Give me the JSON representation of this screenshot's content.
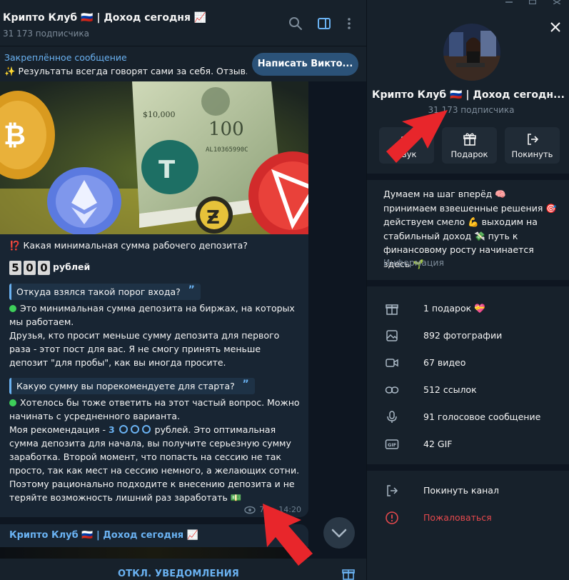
{
  "chat_header": {
    "title": "Крипто Клуб 🇷🇺 | Доход сегодня 📈",
    "subscribers": "31 173 подписчика",
    "icons": [
      "search-icon",
      "sidebar-toggle-icon",
      "more-vert-icon"
    ]
  },
  "pinned": {
    "label": "Закреплённое сообщение",
    "text": "✨ Результаты всегда говорят сами за себя. Отзыв...",
    "button": "Написать Викто..."
  },
  "message": {
    "question": "⁉️ Какая минимальная сумма рабочего депозита?",
    "amount_digits": [
      "5",
      "0",
      "0"
    ],
    "amount_unit": "рублей",
    "quote1": "Откуда взялся такой порог входа?",
    "quote_mark": "”",
    "p1": "Это минимальная сумма депозита на биржах, на которых мы работаем.",
    "p2": "Друзья, кто просит меньше сумму депозита для первого раза - этот пост для вас. Я не смогу принять меньше депозит \"для пробы\", как вы иногда просите.",
    "quote2": "Какую сумму вы порекомендуете для старта?",
    "p3": "Хотелось бы тоже ответить на этот частый вопрос. Можно начинать с усредненного варианта.",
    "p4a": "Моя рекомендация - ",
    "p4_digit": "3",
    "p4b": "рублей. Это оптимальная сумма депозита для начала, вы получите серьезную сумму заработка. Второй момент, что попасть на сессию не так просто, так как мест на сессию немного, а желающих сотни. Поэтому рационально подходите к внесению депозита и не теряйте возможность лишний раз заработать 💵",
    "views": "74",
    "time": "14:20"
  },
  "next_message": {
    "title": "Крипто Клуб 🇷🇺 | Доход сегодня 📈"
  },
  "bottom": {
    "mute": "ОТКЛ. УВЕДОМЛЕНИЯ"
  },
  "profile": {
    "name": "Крипто Клуб 🇷🇺 | Доход сегодн...",
    "subscribers": "31 173 подписчика",
    "actions": [
      {
        "label": "Звук",
        "icon": "sound-icon"
      },
      {
        "label": "Подарок",
        "icon": "gift-icon"
      },
      {
        "label": "Покинуть",
        "icon": "leave-icon"
      }
    ],
    "description": "Думаем на шаг вперёд 🧠 принимаем взвешенные решения 🎯 действуем смело 💪 выходим на стабильный доход 💸 путь к финансовому росту начинается здесь 🌱",
    "info_label": "Информация",
    "media": [
      {
        "label": "1 подарок 💝",
        "icon": "gift-icon"
      },
      {
        "label": "892 фотографии",
        "icon": "photo-icon"
      },
      {
        "label": "67 видео",
        "icon": "video-icon"
      },
      {
        "label": "512 ссылок",
        "icon": "link-icon"
      },
      {
        "label": "91 голосовое сообщение",
        "icon": "microphone-icon"
      },
      {
        "label": "42 GIF",
        "icon": "gif-icon"
      }
    ],
    "leave": "Покинуть канал",
    "report": "Пожаловаться"
  },
  "colors": {
    "accent": "#6ab2f2",
    "panel": "#17212b",
    "background": "#0e1621",
    "danger": "#e5494d",
    "annotation_arrow": "#e8262b"
  }
}
